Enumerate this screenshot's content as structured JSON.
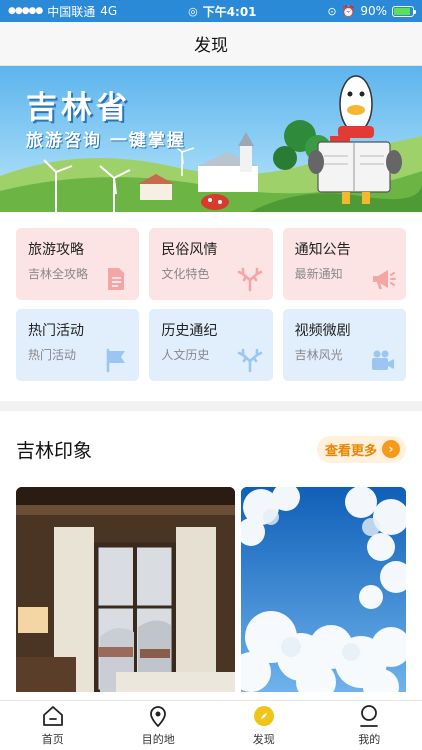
{
  "status_bar": {
    "carrier": "中国联通",
    "network": "4G",
    "time": "下午4:01",
    "battery": "90%",
    "battery_level": 0.9
  },
  "nav": {
    "title": "发现"
  },
  "banner": {
    "title": "吉林省",
    "subtitle": "旅游咨询 一键掌握"
  },
  "grid": {
    "items": [
      {
        "title": "旅游攻略",
        "subtitle": "吉林全攻略",
        "icon": "document-icon",
        "color": "pink"
      },
      {
        "title": "民俗风情",
        "subtitle": "文化特色",
        "icon": "antler-icon",
        "color": "pink"
      },
      {
        "title": "通知公告",
        "subtitle": "最新通知",
        "icon": "megaphone-icon",
        "color": "pink"
      },
      {
        "title": "热门活动",
        "subtitle": "热门活动",
        "icon": "flag-icon",
        "color": "blue"
      },
      {
        "title": "历史通纪",
        "subtitle": "人文历史",
        "icon": "antler-icon",
        "color": "blue"
      },
      {
        "title": "视频微剧",
        "subtitle": "吉林风光",
        "icon": "video-camera-icon",
        "color": "blue"
      }
    ]
  },
  "section": {
    "title": "吉林印象",
    "more_label": "查看更多",
    "more_arrow": "›"
  },
  "tabs": [
    {
      "label": "首页",
      "icon": "home-icon"
    },
    {
      "label": "目的地",
      "icon": "location-pin-icon"
    },
    {
      "label": "发现",
      "icon": "compass-icon",
      "active": true
    },
    {
      "label": "我的",
      "icon": "user-icon"
    }
  ],
  "colors": {
    "status_bar": "#2a8ad8",
    "pink_card": "#fde4e4",
    "blue_card": "#e1eefc",
    "pink_icon": "#f4a5a5",
    "blue_icon": "#9cc6f2",
    "accent_orange": "#f59a1b",
    "active_tab": "#f0c419"
  }
}
